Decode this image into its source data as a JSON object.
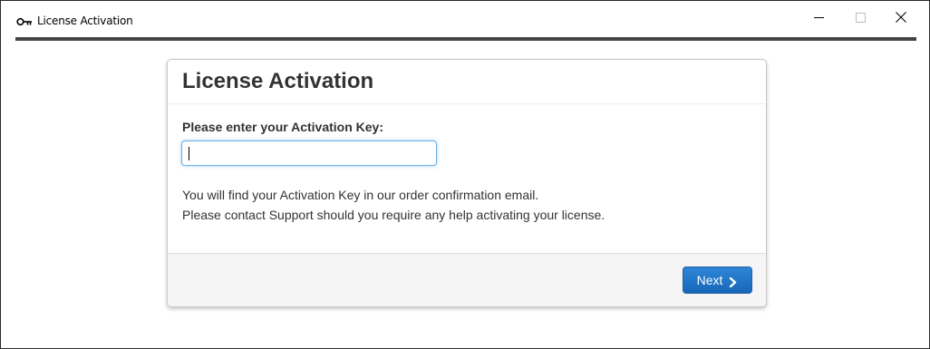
{
  "window": {
    "title": "License Activation",
    "icon": "key-icon",
    "controls": {
      "minimize": "minimize-icon",
      "maximize": "maximize-icon",
      "close": "close-icon"
    }
  },
  "panel": {
    "title": "License Activation",
    "field_label": "Please enter your Activation Key:",
    "activation_key_value": "",
    "activation_key_placeholder": "",
    "info_lines": [
      "You will find your Activation Key in our order confirmation email.",
      "Please contact Support should you require any help activating your license."
    ],
    "next_button": {
      "label": "Next",
      "icon": "chevron-right-icon"
    }
  },
  "colors": {
    "accent_bar": "#444444",
    "primary_button": "#1f6fc5",
    "input_focus": "#66afe9",
    "footer_bg": "#f5f5f5"
  }
}
